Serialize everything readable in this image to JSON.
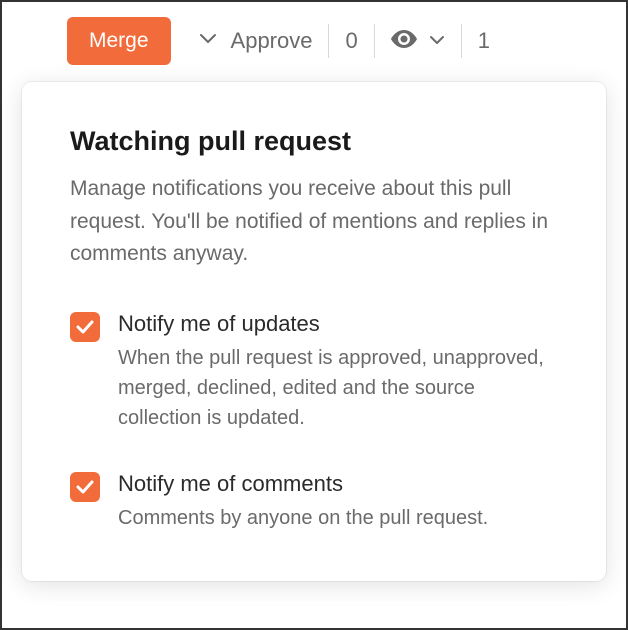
{
  "toolbar": {
    "merge_label": "Merge",
    "approve_label": "Approve",
    "count_zero": "0",
    "count_one": "1"
  },
  "popover": {
    "title": "Watching pull request",
    "description": "Manage notifications you receive about this pull request. You'll be notified of mentions and replies in comments anyway.",
    "options": [
      {
        "title": "Notify me of updates",
        "description": "When the pull request is approved, unapproved, merged, declined, edited and the source collection is updated."
      },
      {
        "title": "Notify me of comments",
        "description": "Comments by anyone on the pull request."
      }
    ]
  }
}
